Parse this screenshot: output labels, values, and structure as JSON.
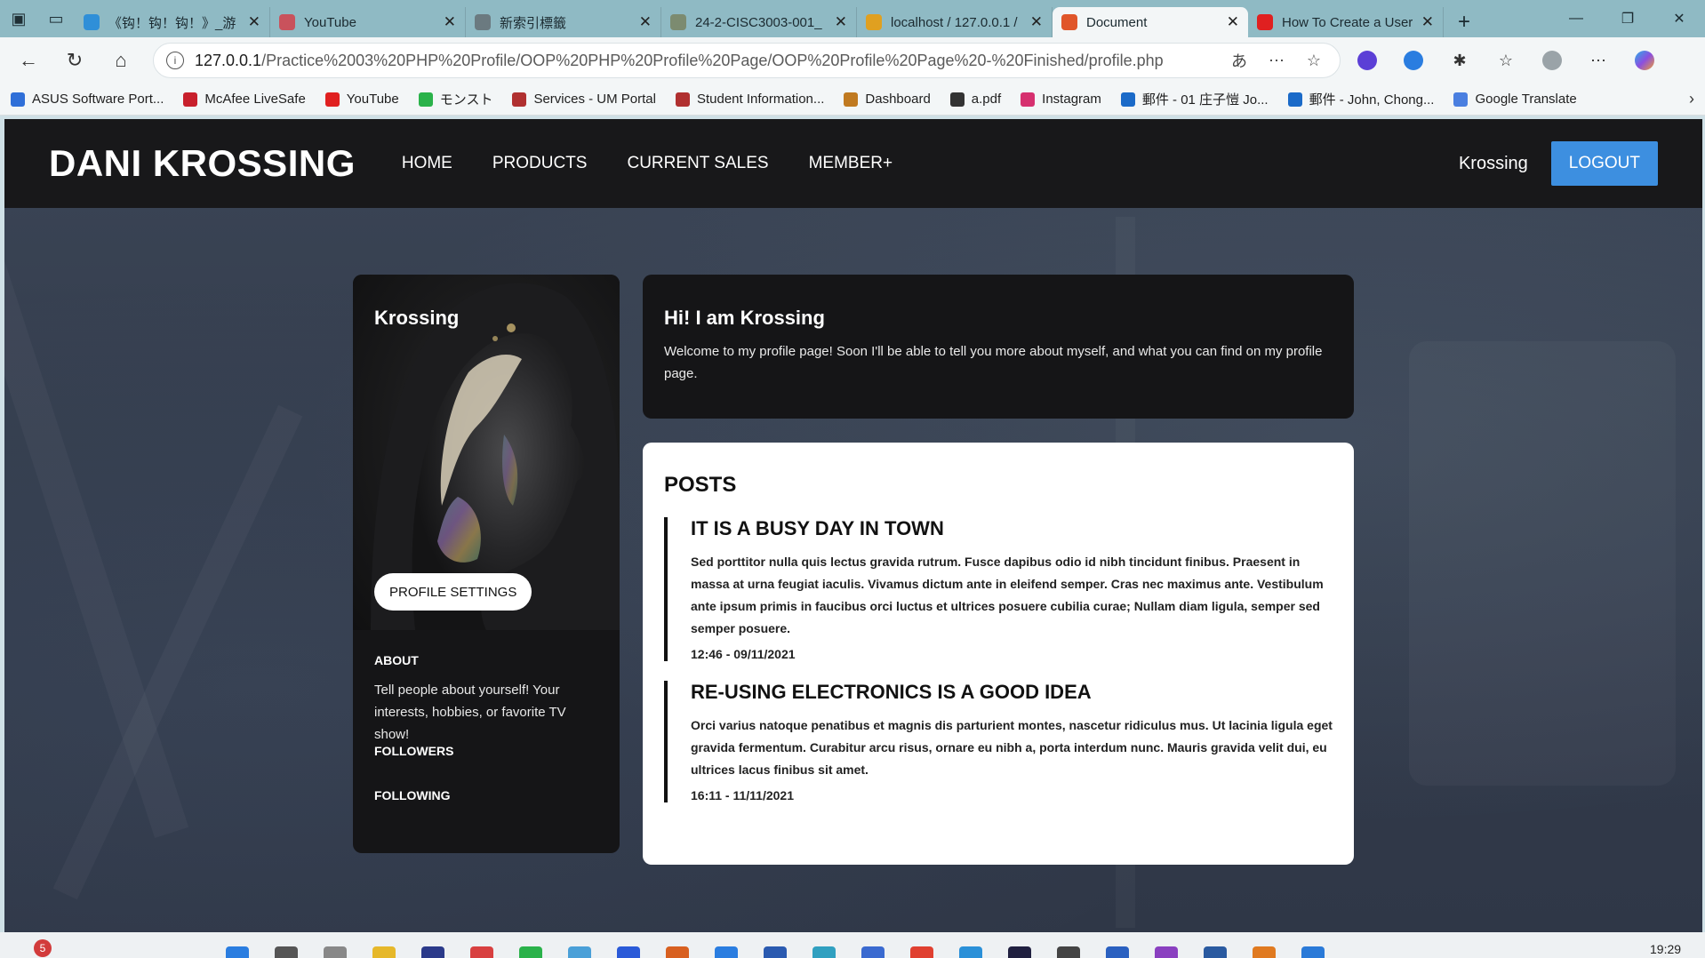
{
  "browser": {
    "tabs": [
      {
        "title": "《钩！钩！钩！》_游",
        "favicon_color": "#2f8fd8",
        "active": false
      },
      {
        "title": "YouTube",
        "favicon_color": "#c9525c",
        "active": false
      },
      {
        "title": "新索引標籤",
        "favicon_color": "#6b7a80",
        "active": false
      },
      {
        "title": "24-2-CISC3003-001_",
        "favicon_color": "#7c8b70",
        "active": false
      },
      {
        "title": "localhost / 127.0.0.1 /",
        "favicon_color": "#e0a020",
        "active": false
      },
      {
        "title": "Document",
        "favicon_color": "#e0562a",
        "active": true
      },
      {
        "title": "How To Create a User",
        "favicon_color": "#e02020",
        "active": false
      }
    ],
    "url_host": "127.0.0.1",
    "url_path": "/Practice%2003%20PHP%20Profile/OOP%20PHP%20Profile%20Page/OOP%20Profile%20Page%20-%20Finished/profile.php",
    "bookmarks": [
      {
        "label": "ASUS Software Port...",
        "color": "#2f6fd8"
      },
      {
        "label": "McAfee LiveSafe",
        "color": "#c8202c"
      },
      {
        "label": "YouTube",
        "color": "#e02020"
      },
      {
        "label": "モンスト",
        "color": "#2ab24a"
      },
      {
        "label": "Services - UM Portal",
        "color": "#b03030"
      },
      {
        "label": "Student Information...",
        "color": "#b03030"
      },
      {
        "label": "Dashboard",
        "color": "#c07a20"
      },
      {
        "label": "a.pdf",
        "color": "#333333"
      },
      {
        "label": "Instagram",
        "color": "#d6306f"
      },
      {
        "label": "郵件 - 01 庄子愷 Jo...",
        "color": "#1a6ac8"
      },
      {
        "label": "郵件 - John, Chong...",
        "color": "#1a6ac8"
      },
      {
        "label": "Google Translate",
        "color": "#4a7fe0"
      }
    ]
  },
  "site": {
    "logo": "DANI KROSSING",
    "nav": [
      "HOME",
      "PRODUCTS",
      "CURRENT SALES",
      "MEMBER+"
    ],
    "username": "Krossing",
    "logout_label": "LOGOUT",
    "accent_color": "#3d8fe0"
  },
  "profile": {
    "name": "Krossing",
    "settings_label": "PROFILE SETTINGS",
    "about_heading": "ABOUT",
    "about_text": "Tell people about yourself! Your interests, hobbies, or favorite TV show!",
    "followers_heading": "FOLLOWERS",
    "following_heading": "FOLLOWING"
  },
  "intro": {
    "title": "Hi! I am Krossing",
    "text": "Welcome to my profile page! Soon I'll be able to tell you more about myself, and what you can find on my profile page."
  },
  "posts": {
    "heading": "POSTS",
    "items": [
      {
        "title": "IT IS A BUSY DAY IN TOWN",
        "body": "Sed porttitor nulla quis lectus gravida rutrum. Fusce dapibus odio id nibh tincidunt finibus. Praesent in massa at urna feugiat iaculis. Vivamus dictum ante in eleifend semper. Cras nec maximus ante. Vestibulum ante ipsum primis in faucibus orci luctus et ultrices posuere cubilia curae; Nullam diam ligula, semper sed semper posuere.",
        "date": "12:46 - 09/11/2021"
      },
      {
        "title": "RE-USING ELECTRONICS IS A GOOD IDEA",
        "body": "Orci varius natoque penatibus et magnis dis parturient montes, nascetur ridiculus mus. Ut lacinia ligula eget gravida fermentum. Curabitur arcu risus, ornare eu nibh a, porta interdum nunc. Mauris gravida velit dui, eu ultrices lacus finibus sit amet.",
        "date": "16:11 - 11/11/2021"
      }
    ]
  },
  "taskbar": {
    "badge_count": "5",
    "time": "19:29"
  }
}
